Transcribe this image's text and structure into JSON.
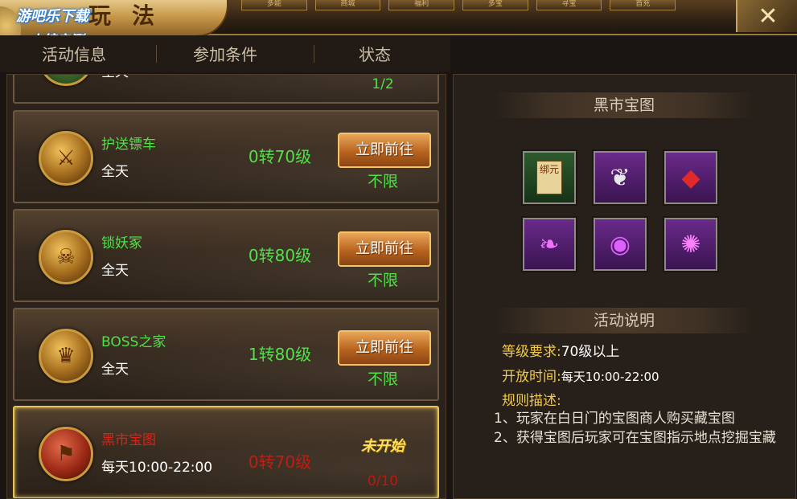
{
  "window": {
    "title": "玩法",
    "close_icon": "close-x-icon"
  },
  "watermark": {
    "line1": "游吧乐下载",
    "line2": "小编亲测"
  },
  "top_tabs": [
    "多能",
    "商城",
    "福利",
    "多宝",
    "寻宝",
    "首充"
  ],
  "columns": {
    "info": "活动信息",
    "condition": "参加条件",
    "status": "状态"
  },
  "partial_row": {
    "time": "全天",
    "count": "1/2"
  },
  "activities": [
    {
      "name": "护送镖车",
      "time": "全天",
      "level": "0转70级",
      "button": "立即前往",
      "limit": "不限",
      "icon": "escort-cart-icon"
    },
    {
      "name": "锁妖冢",
      "time": "全天",
      "level": "0转80级",
      "button": "立即前往",
      "limit": "不限",
      "icon": "demon-tomb-icon"
    },
    {
      "name": "BOSS之家",
      "time": "全天",
      "level": "1转80级",
      "button": "立即前往",
      "limit": "不限",
      "icon": "boss-home-icon"
    },
    {
      "name": "黑市宝图",
      "time": "每天10:00-22:00",
      "level": "0转70级",
      "status": "未开始",
      "limit": "0/10",
      "icon": "black-market-map-icon"
    }
  ],
  "detail": {
    "title": "黑市宝图",
    "rewards": [
      "bound-yuanbao-scroll-icon",
      "feather-icon",
      "red-gem-icon",
      "purple-feather-icon",
      "purple-orb-icon",
      "purple-swirl-icon"
    ],
    "rewards_text": {
      "scroll": "绑元"
    },
    "desc_title": "活动说明",
    "level_label": "等级要求:",
    "level_value": "70级以上",
    "open_label": "开放时间:",
    "open_value": "每天10:00-22:00",
    "rules_label": "规则描述:",
    "rule1": "1、玩家在白日门的宝图商人购买藏宝图",
    "rule2": "2、获得宝图后玩家可在宝图指示地点挖掘宝藏"
  }
}
